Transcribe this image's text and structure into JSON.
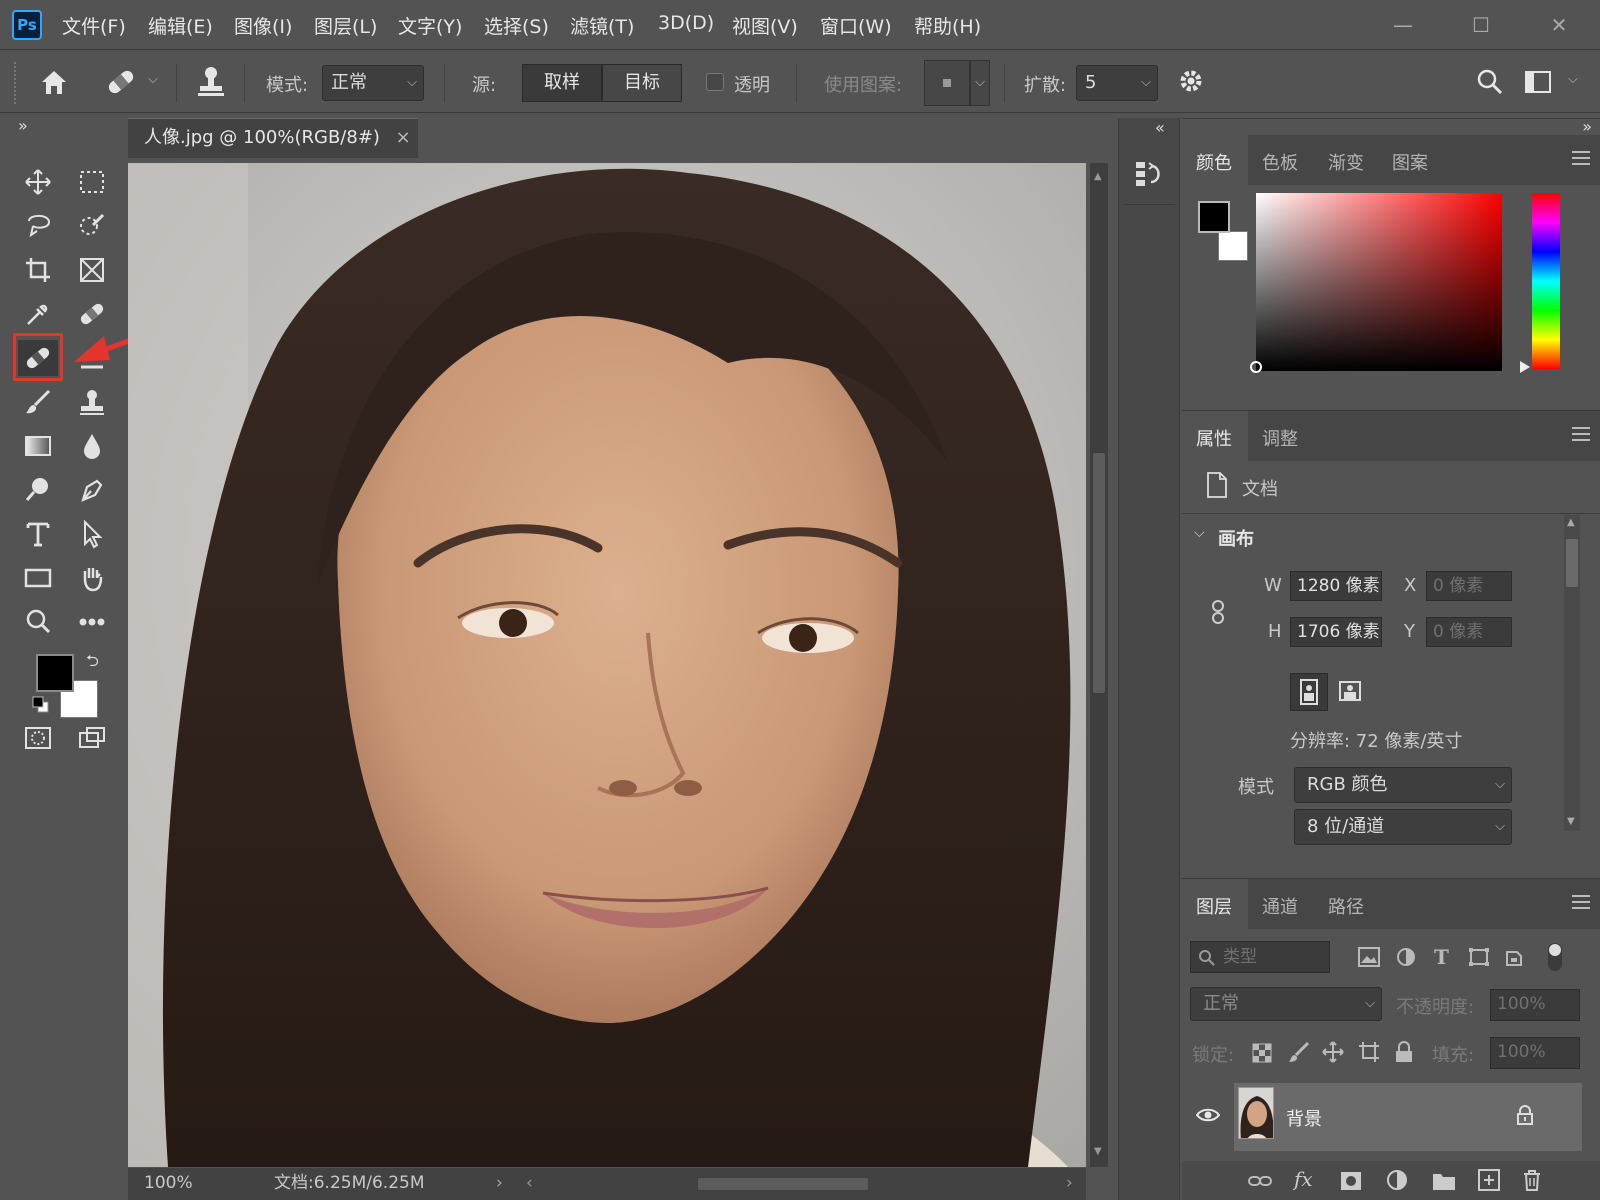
{
  "menubar": {
    "logo": "Ps",
    "items": [
      "文件(F)",
      "编辑(E)",
      "图像(I)",
      "图层(L)",
      "文字(Y)",
      "选择(S)",
      "滤镜(T)",
      "3D(D)",
      "视图(V)",
      "窗口(W)",
      "帮助(H)"
    ],
    "window_controls": {
      "minimize": "—",
      "maximize": "☐",
      "close": "✕"
    }
  },
  "options": {
    "mode_label": "模式:",
    "mode_value": "正常",
    "source_label": "源:",
    "source_sample": "取样",
    "source_target": "目标",
    "transparent_label": "透明",
    "pattern_label": "使用图案:",
    "diffusion_label": "扩散:",
    "diffusion_value": "5"
  },
  "document": {
    "tab_title": "人像.jpg @ 100%(RGB/8#)",
    "tab_close": "×",
    "zoom": "100%",
    "doc_info": "文档:6.25M/6.25M"
  },
  "color_panel": {
    "tabs": [
      "颜色",
      "色板",
      "渐变",
      "图案"
    ],
    "foreground": "#000000",
    "background": "#ffffff",
    "hue": "#ff0000"
  },
  "properties_panel": {
    "tabs": [
      "属性",
      "调整"
    ],
    "doc_label": "文档",
    "section": "画布",
    "w_label": "W",
    "w_value": "1280 像素",
    "h_label": "H",
    "h_value": "1706 像素",
    "x_label": "X",
    "x_value": "0 像素",
    "y_label": "Y",
    "y_value": "0 像素",
    "resolution": "分辨率: 72 像素/英寸",
    "mode_label": "模式",
    "mode_value": "RGB 颜色",
    "depth_value": "8 位/通道"
  },
  "layers_panel": {
    "tabs": [
      "图层",
      "通道",
      "路径"
    ],
    "filter_placeholder": "类型",
    "blend_mode": "正常",
    "opacity_label": "不透明度:",
    "opacity_value": "100%",
    "lock_label": "锁定:",
    "fill_label": "填充:",
    "fill_value": "100%",
    "layer_name": "背景"
  },
  "colors": {
    "ui_bg": "#535353",
    "panel_dark": "#464646",
    "highlight": "#e3342f",
    "ps_blue": "#31a8ff"
  }
}
